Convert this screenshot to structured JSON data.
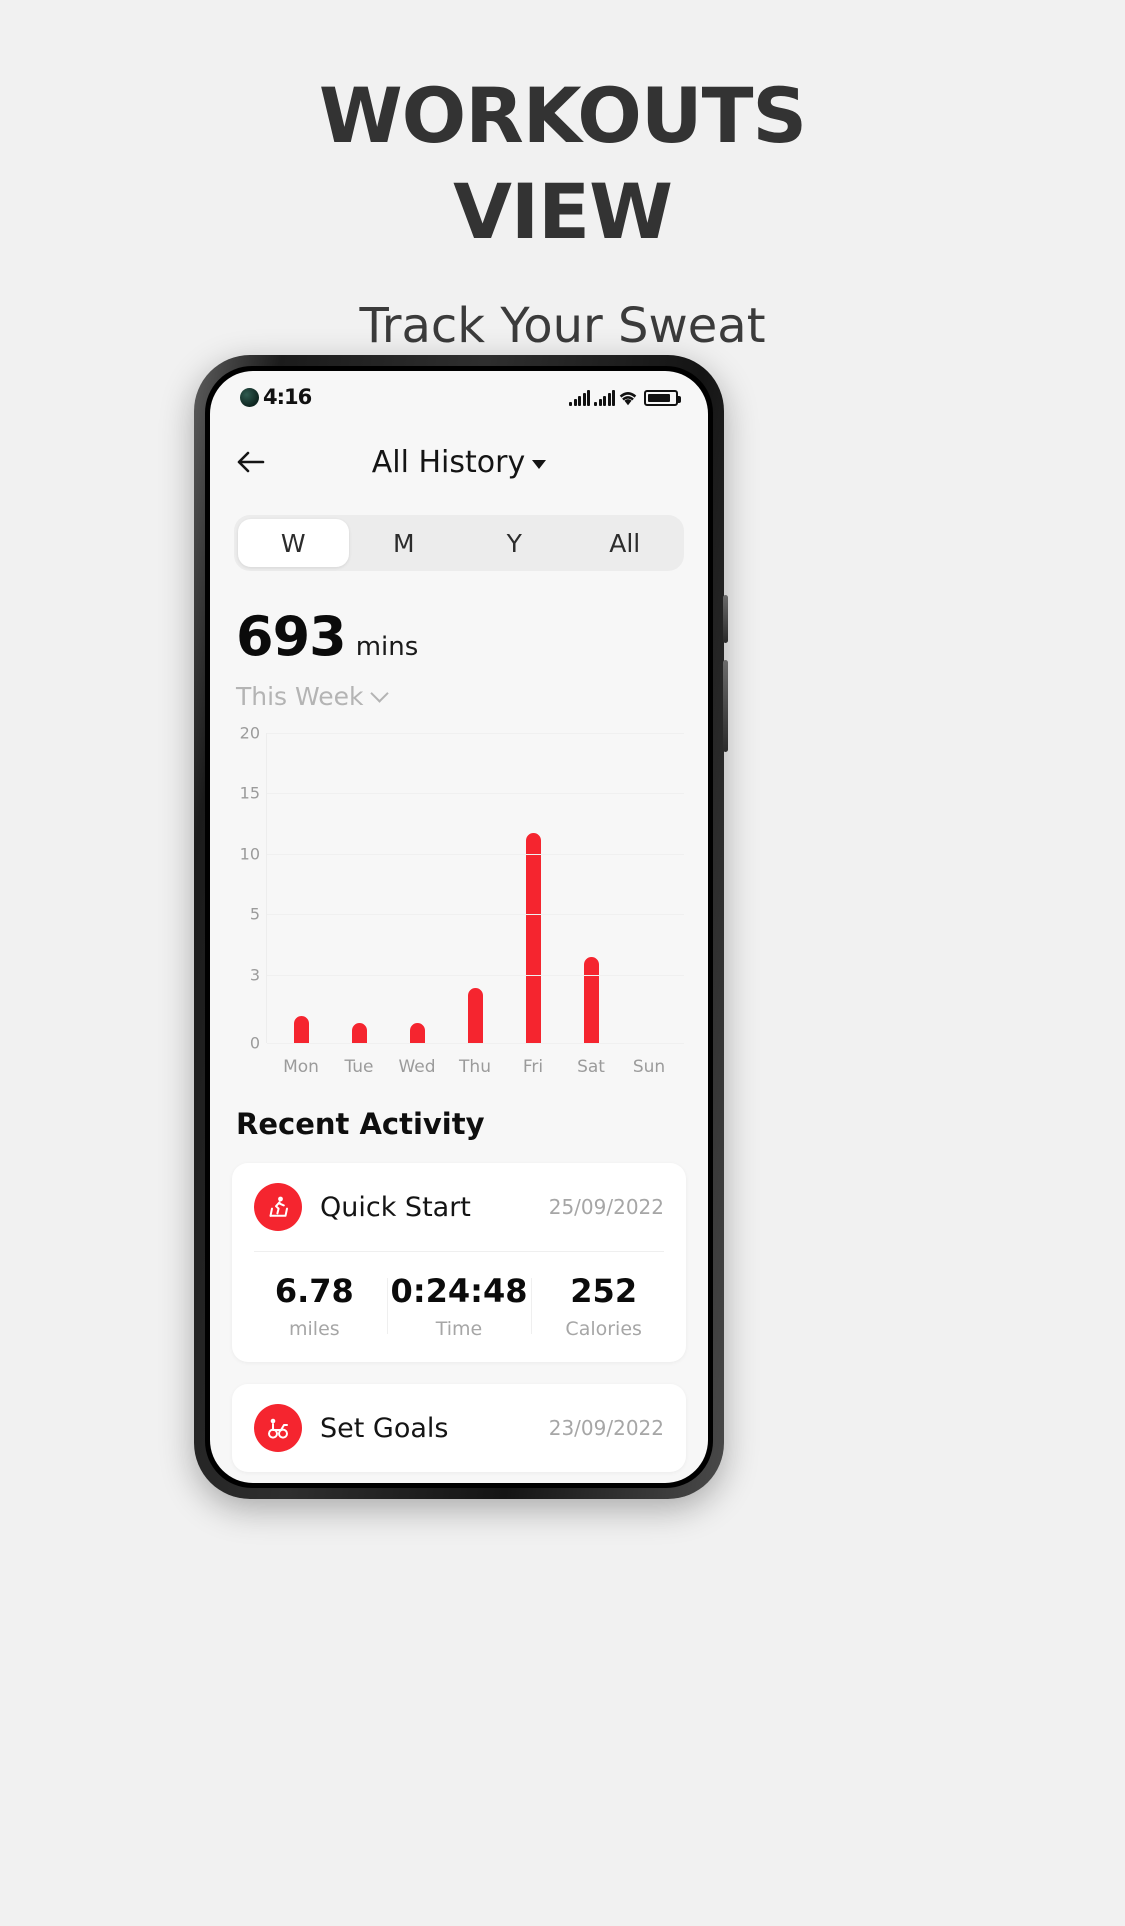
{
  "promo": {
    "title_line1": "WORKOUTS",
    "title_line2": "VIEW",
    "subtitle": "Track Your Sweat",
    "background_color": "#f1f1f1",
    "title_color": "#333333"
  },
  "status_bar": {
    "time": "4:16",
    "icons": [
      "signal-bars-icon",
      "signal-bars-icon",
      "wifi-icon",
      "battery-icon"
    ]
  },
  "app_header": {
    "back_icon": "back-arrow-icon",
    "title": "All History",
    "caret_icon": "caret-down-icon"
  },
  "segmented_control": {
    "options": [
      {
        "label": "W",
        "selected": true
      },
      {
        "label": "M",
        "selected": false
      },
      {
        "label": "Y",
        "selected": false
      },
      {
        "label": "All",
        "selected": false
      }
    ]
  },
  "summary": {
    "value": "693",
    "unit": "mins",
    "period": "This Week",
    "period_chevron": "chevron-down-icon"
  },
  "chart_data": {
    "type": "bar",
    "title": "",
    "xlabel": "",
    "ylabel": "",
    "categories": [
      "Mon",
      "Tue",
      "Wed",
      "Thu",
      "Fri",
      "Sat",
      "Sun"
    ],
    "values": [
      1.2,
      0.9,
      0.9,
      2.4,
      11.7,
      3.6,
      0
    ],
    "yticks": [
      20,
      15,
      10,
      5,
      3,
      0
    ],
    "ylim": [
      0,
      20
    ],
    "grid": true,
    "legend": "none",
    "bar_color": "#f5252f"
  },
  "recent": {
    "section_title": "Recent Activity",
    "items": [
      {
        "icon": "treadmill-runner-icon",
        "name": "Quick Start",
        "date": "25/09/2022",
        "stats": [
          {
            "value": "6.78",
            "label": "miles"
          },
          {
            "value": "0:24:48",
            "label": "Time"
          },
          {
            "value": "252",
            "label": "Calories"
          }
        ]
      },
      {
        "icon": "goal-flag-icon",
        "name": "Set Goals",
        "date": "23/09/2022",
        "stats": []
      }
    ]
  },
  "colors": {
    "accent": "#f5252f",
    "screen_bg": "#f7f7f7",
    "card_bg": "#ffffff",
    "muted_text": "#a6a6a6"
  }
}
